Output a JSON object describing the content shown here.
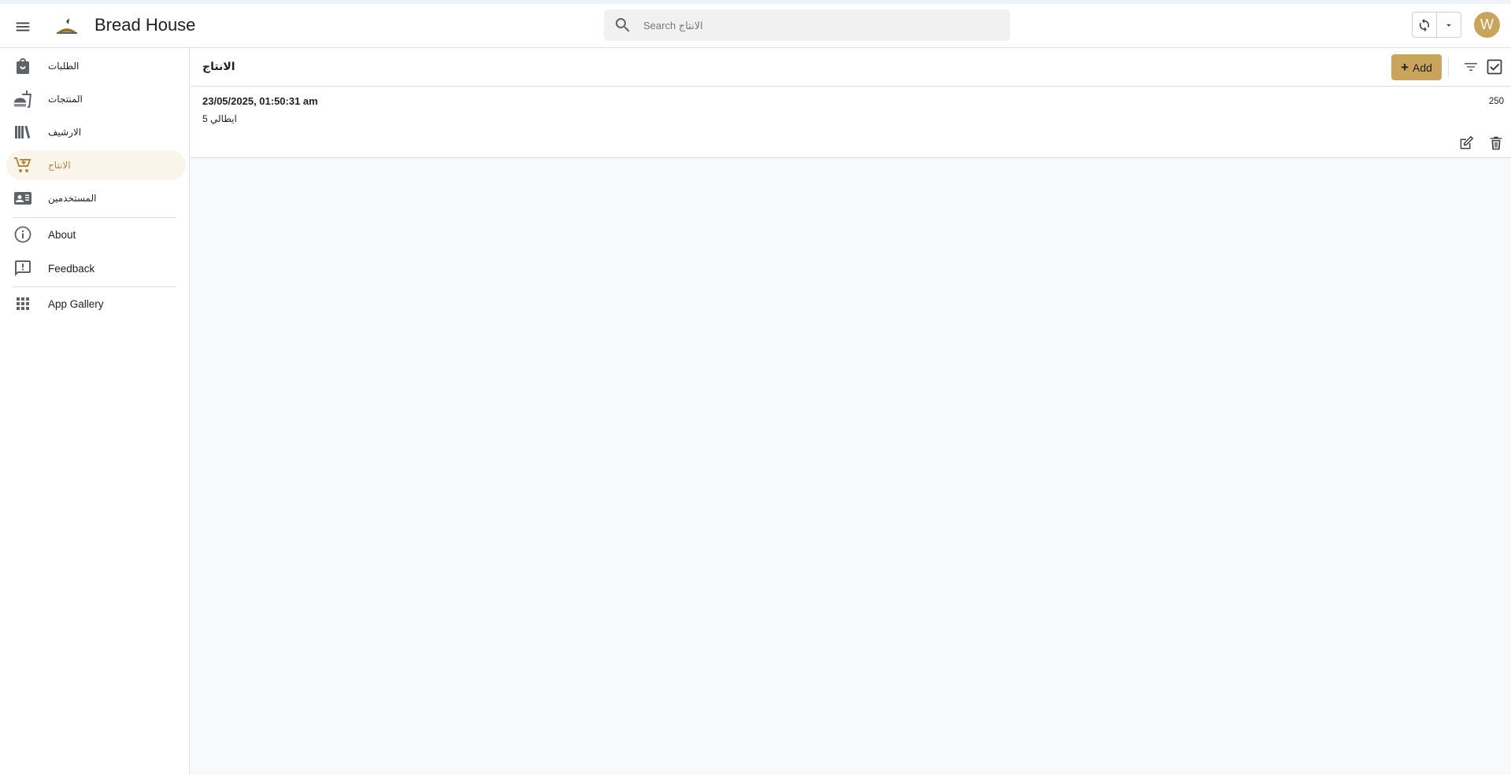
{
  "header": {
    "app_title": "Bread House",
    "search_placeholder": "Search الانتاج",
    "avatar_initial": "W"
  },
  "sidebar": {
    "items": [
      {
        "label": "الطلبات",
        "icon": "shopping-bag-icon"
      },
      {
        "label": "المنتجات",
        "icon": "fastfood-icon"
      },
      {
        "label": "الارشيف",
        "icon": "library-books-icon"
      },
      {
        "label": "الانتاج",
        "icon": "cart-arrow-icon",
        "active": true
      },
      {
        "label": "المستخدمين",
        "icon": "contact-card-icon"
      }
    ],
    "secondary": [
      {
        "label": "About",
        "icon": "info-icon"
      },
      {
        "label": "Feedback",
        "icon": "feedback-icon"
      }
    ],
    "gallery": {
      "label": "App Gallery",
      "icon": "apps-grid-icon"
    }
  },
  "main": {
    "title": "الانتاج",
    "add_label": "Add",
    "records": [
      {
        "date": "23/05/2025, 01:50:31 am",
        "name": "ايطالي 5",
        "quantity": "250"
      }
    ]
  },
  "colors": {
    "accent": "#c9a45c",
    "active_bg": "#faf4ea",
    "active_text": "#b08a3e",
    "content_bg": "#f8f9fb"
  }
}
